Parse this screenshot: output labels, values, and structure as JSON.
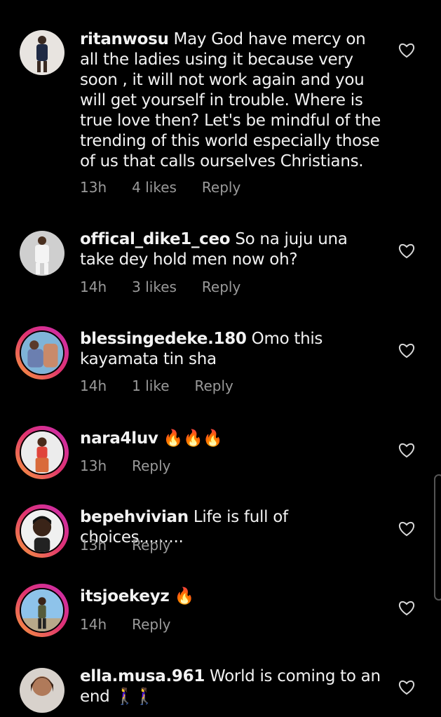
{
  "comments": [
    {
      "username": "ritanwosu",
      "text": "May God have mercy on all the ladies using it because very soon , it will not work again and you will get yourself in trouble. Where is true love then? Let's be mindful of the trending of this world especially those of us that calls ourselves Christians.",
      "time": "13h",
      "likes": "4 likes",
      "reply": "Reply",
      "story_ring": false
    },
    {
      "username": "offical_dike1_ceo",
      "text": "So na juju una take dey hold men now oh?",
      "time": "14h",
      "likes": "3 likes",
      "reply": "Reply",
      "story_ring": false
    },
    {
      "username": "blessingedeke.180",
      "text": "Omo this kayamata tin sha",
      "time": "14h",
      "likes": "1 like",
      "reply": "Reply",
      "story_ring": true
    },
    {
      "username": "nara4luv",
      "text": "🔥🔥🔥",
      "time": "13h",
      "likes": "",
      "reply": "Reply",
      "story_ring": true
    },
    {
      "username": "bepehvivian",
      "text": "Life is full of choices.........",
      "time": "13h",
      "likes": "",
      "reply": "Reply",
      "story_ring": true
    },
    {
      "username": "itsjoekeyz",
      "text": "🔥",
      "time": "14h",
      "likes": "",
      "reply": "Reply",
      "story_ring": true
    },
    {
      "username": "ella.musa.961",
      "text": "World is coming to an end 🚶‍♀️🚶‍♀️",
      "time": "",
      "likes": "",
      "reply": "",
      "story_ring": false
    }
  ],
  "icons": {
    "like": "heart-outline-icon"
  },
  "colors": {
    "background": "#000000",
    "text": "#f2f2f2",
    "meta": "#9a9a9a",
    "story_ring": [
      "#f9a13a",
      "#e0336f",
      "#c92bb4"
    ]
  }
}
